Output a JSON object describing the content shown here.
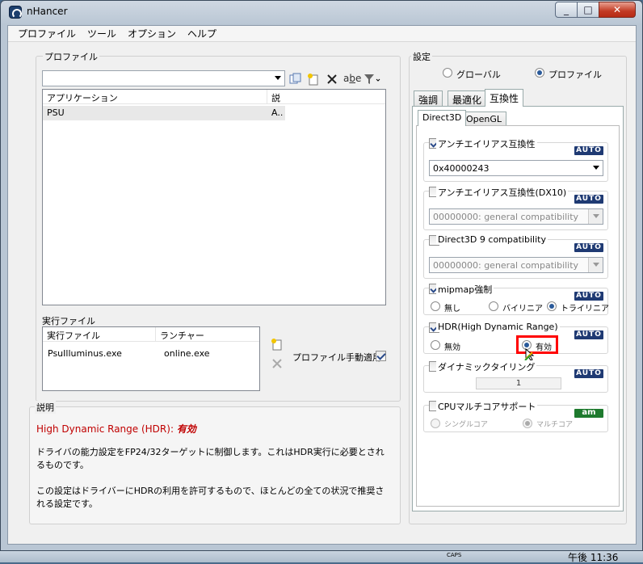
{
  "window": {
    "title": "nHancer",
    "min": "_",
    "max": "□",
    "close": "✕"
  },
  "menu": [
    "プロファイル",
    "ツール",
    "オプション",
    "ヘルプ"
  ],
  "profile": {
    "group_label": "プロファイル",
    "combo_value": "",
    "columns": [
      "アプリケーション",
      "説"
    ],
    "rows": [
      {
        "app": "PSU",
        "desc": "A.."
      }
    ]
  },
  "exe": {
    "group_label": "実行ファイル",
    "columns": [
      "実行ファイル",
      "ランチャー"
    ],
    "rows": [
      {
        "exe": "PsuIlluminus.exe",
        "launcher": "online.exe"
      }
    ],
    "manual_apply_label": "プロファイル手動適用",
    "manual_apply_checked": true
  },
  "description": {
    "group_label": "説明",
    "heading": "High Dynamic Range (HDR):",
    "heading_value": "有効",
    "para1": "ドライバの能力設定をFP24/32ターゲットに制御します。これはHDR実行に必要とされるものです。",
    "para2": "この設定はドライバーにHDRの利用を許可するもので、ほとんどの全ての状況で推奨される設定です。"
  },
  "settings": {
    "group_label": "設定",
    "scope": {
      "global": "グローバル",
      "profile": "プロファイル",
      "selected": "profile"
    },
    "tabs": [
      "強調",
      "最適化",
      "互換性"
    ],
    "selected_tab": "互換性",
    "subtabs": [
      "Direct3D",
      "OpenGL"
    ],
    "selected_subtab": "Direct3D",
    "aa_compat": {
      "label": "アンチエイリアス互換性",
      "checked": true,
      "value": "0x40000243",
      "badge": "AUTO"
    },
    "aa_compat_dx10": {
      "label": "アンチエイリアス互換性(DX10)",
      "checked": false,
      "value": "00000000: general compatibility",
      "badge": "AUTO"
    },
    "d3d9_compat": {
      "label": "Direct3D 9 compatibility",
      "checked": false,
      "value": "00000000: general compatibility",
      "badge": "AUTO"
    },
    "mipmap": {
      "label": "mipmap強制",
      "checked": true,
      "options": [
        "無し",
        "バイリニア",
        "トライリニア"
      ],
      "selected": "トライリニア",
      "badge": "AUTO"
    },
    "hdr": {
      "label": "HDR(High Dynamic Range)",
      "checked": true,
      "options": [
        "無効",
        "有効"
      ],
      "selected": "有効",
      "badge": "AUTO"
    },
    "dynamic_tiling": {
      "label": "ダイナミックタイリング",
      "checked": false,
      "value": "1",
      "badge": "AUTO"
    },
    "cpu_multicore": {
      "label": "CPUマルチコアサポート",
      "checked": false,
      "options": [
        "シングルコア",
        "マルチコア"
      ],
      "selected": "マルチコア",
      "badge": "am"
    }
  },
  "colors": {
    "highlight_box": "#ff0000",
    "description_heading": "#c00000",
    "auto_badge": "#1f3a73",
    "am_badge": "#1e7a2e"
  },
  "taskbar": {
    "caps": "CAPS",
    "time": "午後 11:36"
  }
}
